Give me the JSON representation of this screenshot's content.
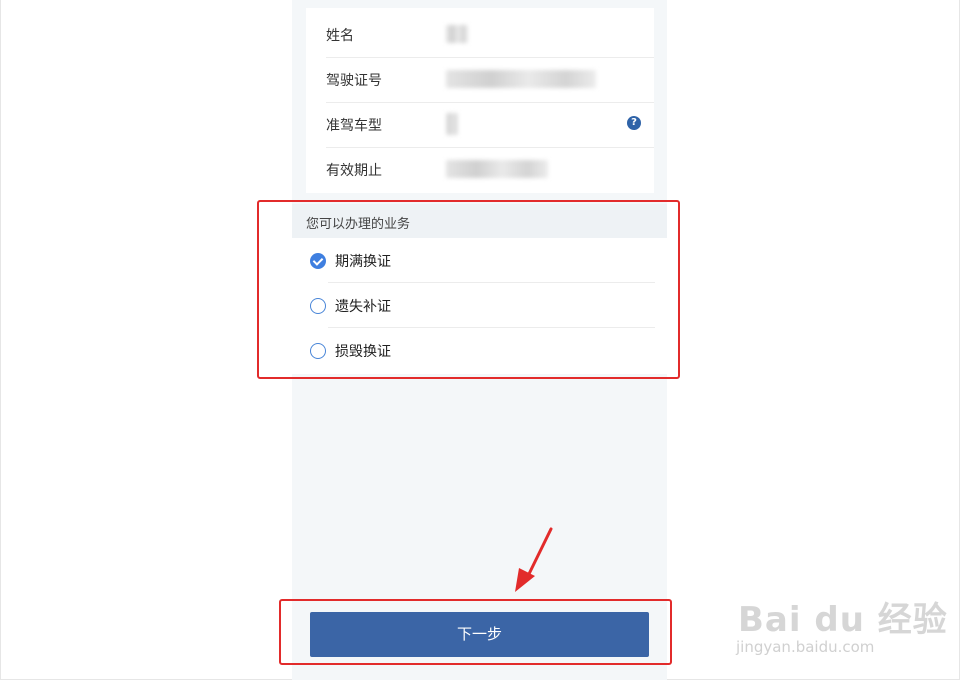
{
  "driver_info": {
    "rows": [
      {
        "label": "姓名"
      },
      {
        "label": "驾驶证号"
      },
      {
        "label": "准驾车型"
      },
      {
        "label": "有效期止"
      }
    ],
    "help_icon_glyph": "?"
  },
  "services": {
    "title": "您可以办理的业务",
    "options": [
      {
        "label": "期满换证",
        "checked": true
      },
      {
        "label": "遗失补证",
        "checked": false
      },
      {
        "label": "损毁换证",
        "checked": false
      }
    ]
  },
  "next_button": {
    "label": "下一步"
  },
  "watermark": {
    "logo": "Bai du 经验",
    "url": "jingyan.baidu.com"
  },
  "colors": {
    "primary_button": "#3b65a6",
    "radio_checked": "#3f7fe0",
    "highlight": "#e22b2b"
  }
}
